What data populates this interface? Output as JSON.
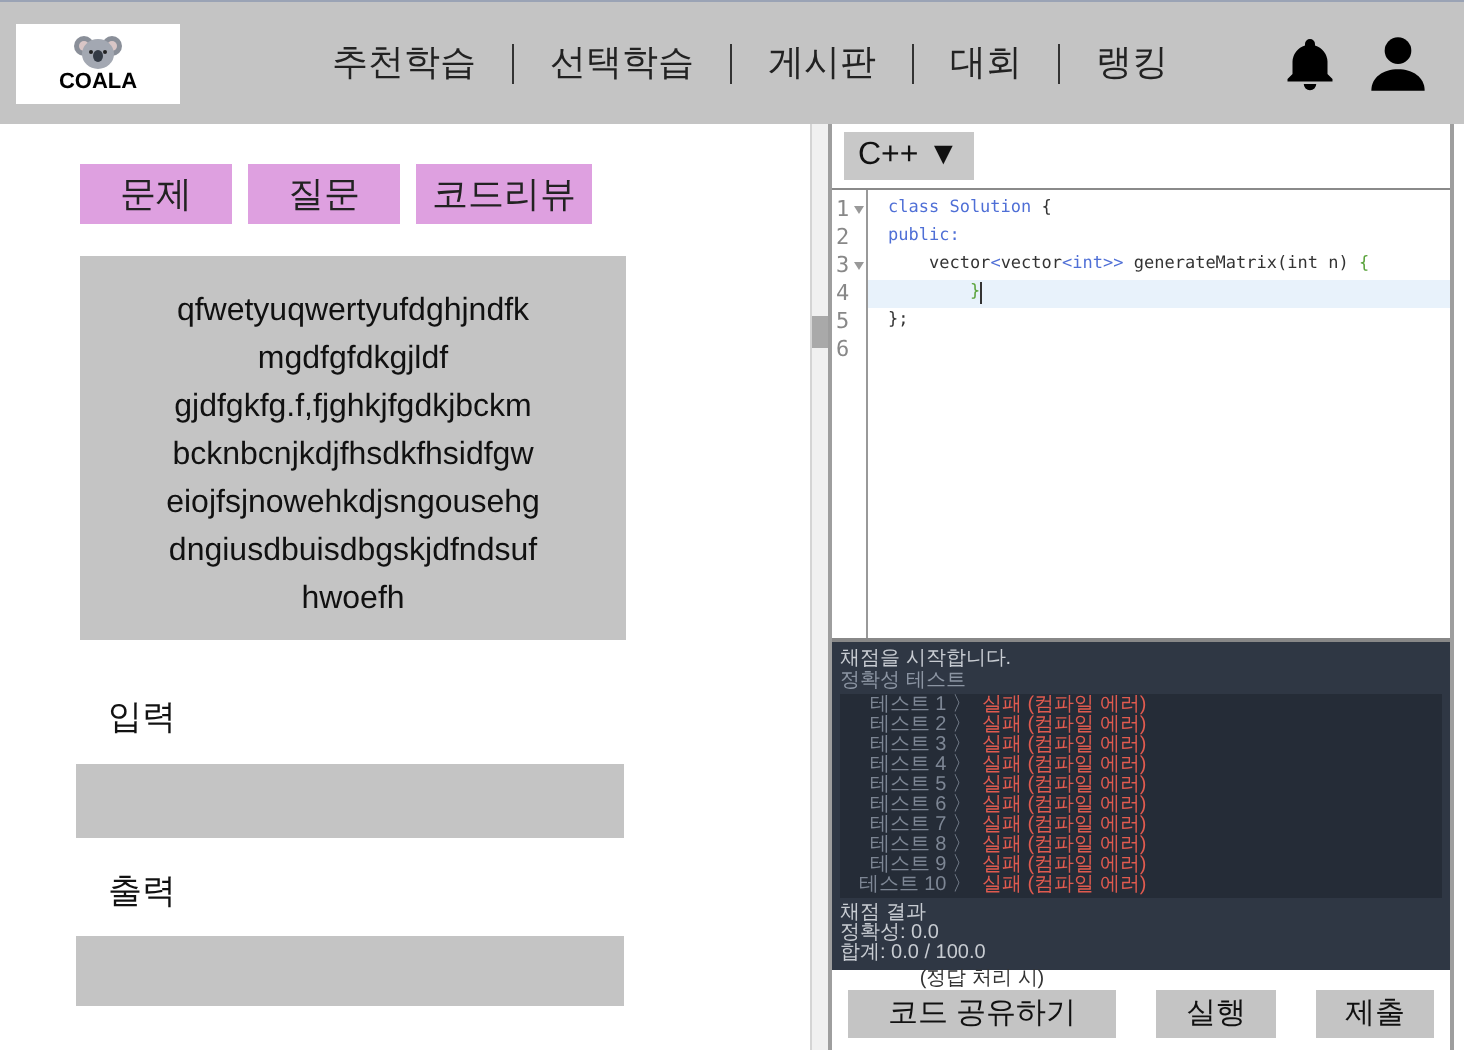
{
  "header": {
    "logo": "COALA",
    "nav": [
      {
        "label": "추천학습"
      },
      {
        "label": "선택학습"
      },
      {
        "label": "게시판"
      },
      {
        "label": "대회"
      },
      {
        "label": "랭킹"
      }
    ]
  },
  "problem": {
    "tabs": [
      {
        "label": "문제"
      },
      {
        "label": "질문"
      },
      {
        "label": "코드리뷰"
      }
    ],
    "description": "qfwetyuqwertyufdghjndfk mgdfgfdkgjldf gjdfgkfg.f,fjghkjfgdkjbckm bcknbcnjkdjfhsdkfhsidfgw eiojfsjnowehkdjsngousehg dngiusdbuisdbgskjdfndsuf hwoefh",
    "input_label": "입력",
    "output_label": "출력"
  },
  "editor": {
    "language": "C++ ▼",
    "lines": [
      {
        "number": "1",
        "fold": true,
        "tokens": [
          {
            "kind": "keyword",
            "text": "class Solution"
          },
          {
            "kind": "plain",
            "text": " {"
          }
        ]
      },
      {
        "number": "2",
        "fold": false,
        "tokens": [
          {
            "kind": "keyword",
            "text": "public:"
          }
        ]
      },
      {
        "number": "3",
        "fold": true,
        "tokens": [
          {
            "kind": "plain",
            "text": "    vector"
          },
          {
            "kind": "keyword",
            "text": "<"
          },
          {
            "kind": "plain",
            "text": "vector"
          },
          {
            "kind": "keyword",
            "text": "<int>>"
          },
          {
            "kind": "plain",
            "text": " generateMatrix(int n) "
          },
          {
            "kind": "brace",
            "text": "{"
          }
        ]
      },
      {
        "number": "4",
        "fold": false,
        "active": true,
        "tokens": [
          {
            "kind": "brace",
            "text": "        }"
          }
        ]
      },
      {
        "number": "5",
        "fold": false,
        "tokens": [
          {
            "kind": "plain",
            "text": "};"
          }
        ]
      },
      {
        "number": "6",
        "fold": false
      }
    ]
  },
  "console": {
    "title": "채점을 시작합니다.",
    "subtitle": "정확성  테스트",
    "results": [
      {
        "test": "테스트 1 〉",
        "result": "실패 (컴파일 에러)"
      },
      {
        "test": "테스트 2 〉",
        "result": "실패 (컴파일 에러)"
      },
      {
        "test": "테스트 3 〉",
        "result": "실패 (컴파일 에러)"
      },
      {
        "test": "테스트 4 〉",
        "result": "실패 (컴파일 에러)"
      },
      {
        "test": "테스트 5 〉",
        "result": "실패 (컴파일 에러)"
      },
      {
        "test": "테스트 6 〉",
        "result": "실패 (컴파일 에러)"
      },
      {
        "test": "테스트 7 〉",
        "result": "실패 (컴파일 에러)"
      },
      {
        "test": "테스트 8 〉",
        "result": "실패 (컴파일 에러)"
      },
      {
        "test": "테스트 9 〉",
        "result": "실패 (컴파일 에러)"
      },
      {
        "test": "테스트 10 〉",
        "result": "실패 (컴파일 에러)"
      }
    ],
    "summary": [
      "채점 결과",
      "정확성: 0.0",
      "합계: 0.0 / 100.0"
    ]
  },
  "actions": {
    "share_note": "(정답 처리 시)",
    "buttons": [
      {
        "label": "코드 공유하기"
      },
      {
        "label": "실행"
      },
      {
        "label": "제출"
      }
    ]
  }
}
